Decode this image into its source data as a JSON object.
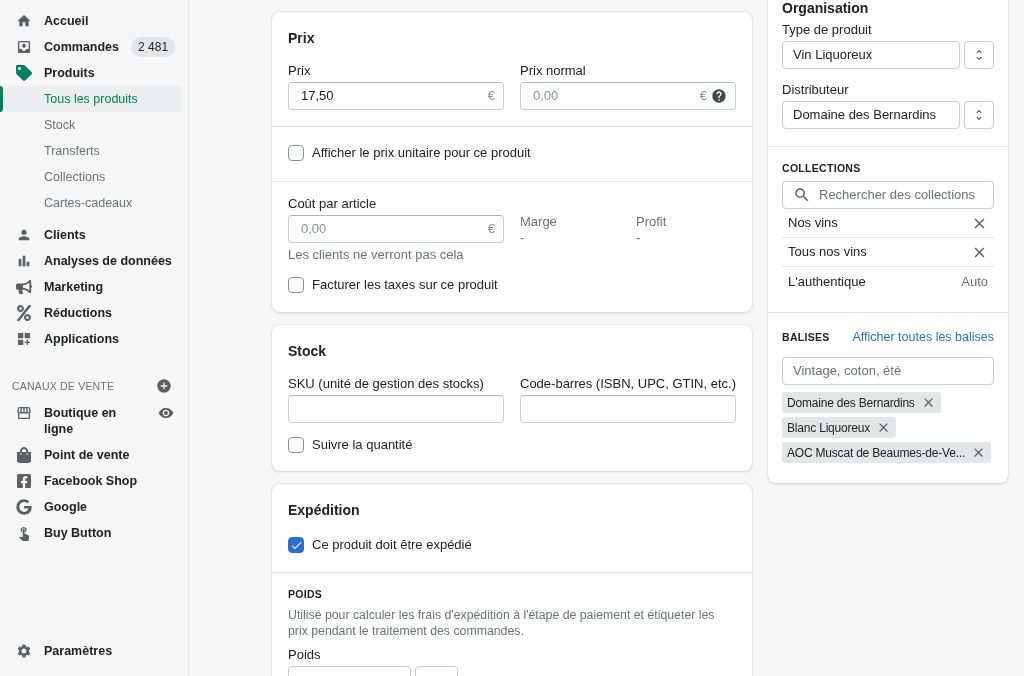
{
  "sidebar": {
    "items": [
      {
        "label": "Accueil",
        "selected": false
      },
      {
        "label": "Commandes",
        "selected": false,
        "badge": "2 481"
      },
      {
        "label": "Produits",
        "selected": false,
        "children": [
          {
            "label": "Tous les produits",
            "selected": true
          },
          {
            "label": "Stock",
            "selected": false
          },
          {
            "label": "Transferts",
            "selected": false
          },
          {
            "label": "Collections",
            "selected": false
          },
          {
            "label": "Cartes-cadeaux",
            "selected": false
          }
        ]
      },
      {
        "label": "Clients",
        "selected": false
      },
      {
        "label": "Analyses de données",
        "selected": false
      },
      {
        "label": "Marketing",
        "selected": false
      },
      {
        "label": "Réductions",
        "selected": false
      },
      {
        "label": "Applications",
        "selected": false
      }
    ],
    "channels": {
      "heading": "CANAUX DE VENTE",
      "items": [
        {
          "label": "Boutique en ligne",
          "kind": "viewable"
        },
        {
          "label": "Point de vente",
          "kind": "plain"
        },
        {
          "label": "Facebook Shop",
          "kind": "plain"
        },
        {
          "label": "Google",
          "kind": "plain"
        },
        {
          "label": "Buy Button",
          "kind": "plain"
        }
      ]
    },
    "settings": "Paramètres"
  },
  "pricing": {
    "title": "Prix",
    "price": {
      "label": "Prix",
      "value": "17,50",
      "suffix": "€"
    },
    "compare_price": {
      "label": "Prix normal",
      "placeholder": "0,00",
      "suffix": "€"
    },
    "unit_price": {
      "label": "Afficher le prix unitaire pour ce produit",
      "checked": false
    },
    "cost": {
      "label": "Coût par article",
      "placeholder": "0,00",
      "suffix": "€",
      "help": "Les clients ne verront pas cela"
    },
    "margin": {
      "label": "Marge",
      "value": "-"
    },
    "profit": {
      "label": "Profit",
      "value": "-"
    },
    "taxes": {
      "label": "Facturer les taxes sur ce produit",
      "checked": false
    }
  },
  "stock": {
    "title": "Stock",
    "sku": {
      "label": "SKU (unité de gestion des stocks)"
    },
    "barcode": {
      "label": "Code-barres (ISBN, UPC, GTIN, etc.)"
    },
    "track": {
      "label": "Suivre la quantité",
      "checked": false
    }
  },
  "shipping": {
    "title": "Expédition",
    "ship": {
      "label": "Ce produit doit être expédié",
      "checked": true
    },
    "weight": {
      "heading": "POIDS",
      "help": "Utilisé pour calculer les frais d'expédition à l'étape de paiement et étiqueter les prix pendant le traitement des commandes.",
      "label": "Poids"
    }
  },
  "organisation": {
    "title": "Organisation",
    "product_type": {
      "label": "Type de produit",
      "value": "Vin Liquoreux"
    },
    "vendor": {
      "label": "Distributeur",
      "value": "Domaine des Bernardins"
    },
    "collections": {
      "heading": "COLLECTIONS",
      "placeholder": "Rechercher des collections",
      "items": [
        {
          "label": "Nos vins",
          "kind": "manual"
        },
        {
          "label": "Tous nos vins",
          "kind": "manual"
        },
        {
          "label": "L'authentique",
          "kind": "auto",
          "note": "Auto"
        }
      ]
    },
    "tags": {
      "heading": "BALISES",
      "link": "Afficher toutes les balises",
      "placeholder": "Vintage, coton, été",
      "items": [
        "Domaine des Bernardins",
        "Blanc Liquoreux",
        "AOC Muscat de Beaumes-de-Ve..."
      ]
    }
  }
}
